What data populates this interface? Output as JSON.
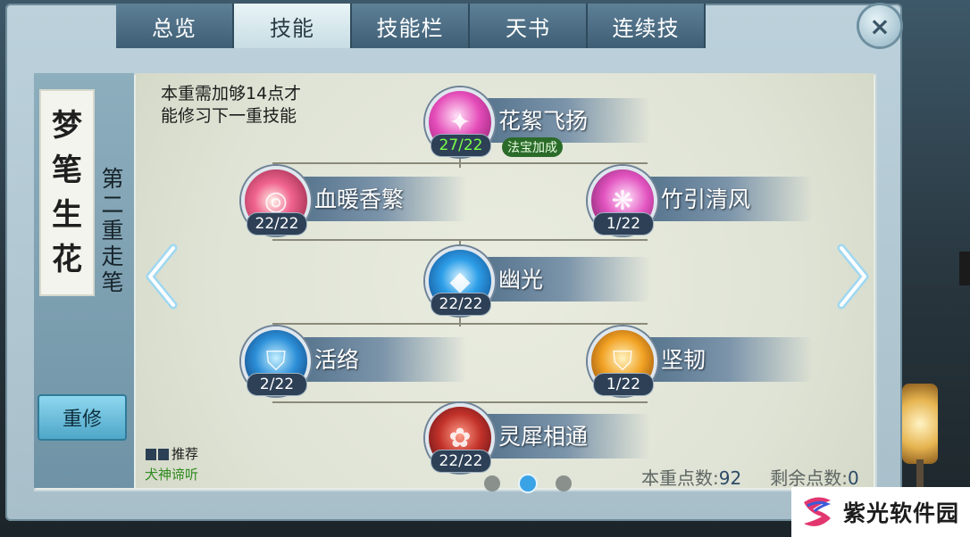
{
  "tabs": [
    {
      "label": "总览",
      "active": false
    },
    {
      "label": "技能",
      "active": true
    },
    {
      "label": "技能栏",
      "active": false
    },
    {
      "label": "天书",
      "active": false
    },
    {
      "label": "连续技",
      "active": false
    }
  ],
  "close_icon": "×",
  "book": {
    "title_chars": [
      "梦",
      "笔",
      "生",
      "花"
    ],
    "subtitle_chars": [
      "第",
      "二",
      "重",
      "走",
      "笔"
    ]
  },
  "requirement_text_line1": "本重需加够14点才",
  "requirement_text_line2": "能修习下一重技能",
  "reset_label": "重修",
  "skills": [
    {
      "name": "花絮飞扬",
      "count": "27/22",
      "count_full": true,
      "tag": "法宝加成",
      "orb": "orb-pink",
      "icon": "pink-burst-icon"
    },
    {
      "name": "血暖香繁",
      "count": "22/22",
      "count_full": false,
      "orb": "orb-rose",
      "icon": "crimson-swirl-icon"
    },
    {
      "name": "竹引清风",
      "count": "1/22",
      "count_full": false,
      "orb": "orb-magenta",
      "icon": "pink-wind-icon"
    },
    {
      "name": "幽光",
      "count": "22/22",
      "count_full": false,
      "orb": "orb-blue",
      "icon": "blue-crystal-icon"
    },
    {
      "name": "活络",
      "count": "2/22",
      "count_full": false,
      "orb": "orb-shield-blue",
      "icon": "blue-shield-icon"
    },
    {
      "name": "坚韧",
      "count": "1/22",
      "count_full": false,
      "orb": "orb-shield-gold",
      "icon": "gold-shield-icon"
    },
    {
      "name": "灵犀相通",
      "count": "22/22",
      "count_full": false,
      "orb": "orb-red",
      "icon": "red-fox-icon"
    }
  ],
  "recommend": {
    "label": "推荐",
    "name": "犬神谛听"
  },
  "points": {
    "current_label": "本重点数:",
    "current_value": "92",
    "remaining_label": "剩余点数:",
    "remaining_value": "0"
  },
  "pages": {
    "count": 3,
    "active_index": 1
  },
  "watermark": {
    "text": "紫光软件园"
  },
  "colors": {
    "accent_blue": "#3aa3e6",
    "count_full_green": "#7aff48",
    "tag_green": "#2b6b2a"
  }
}
